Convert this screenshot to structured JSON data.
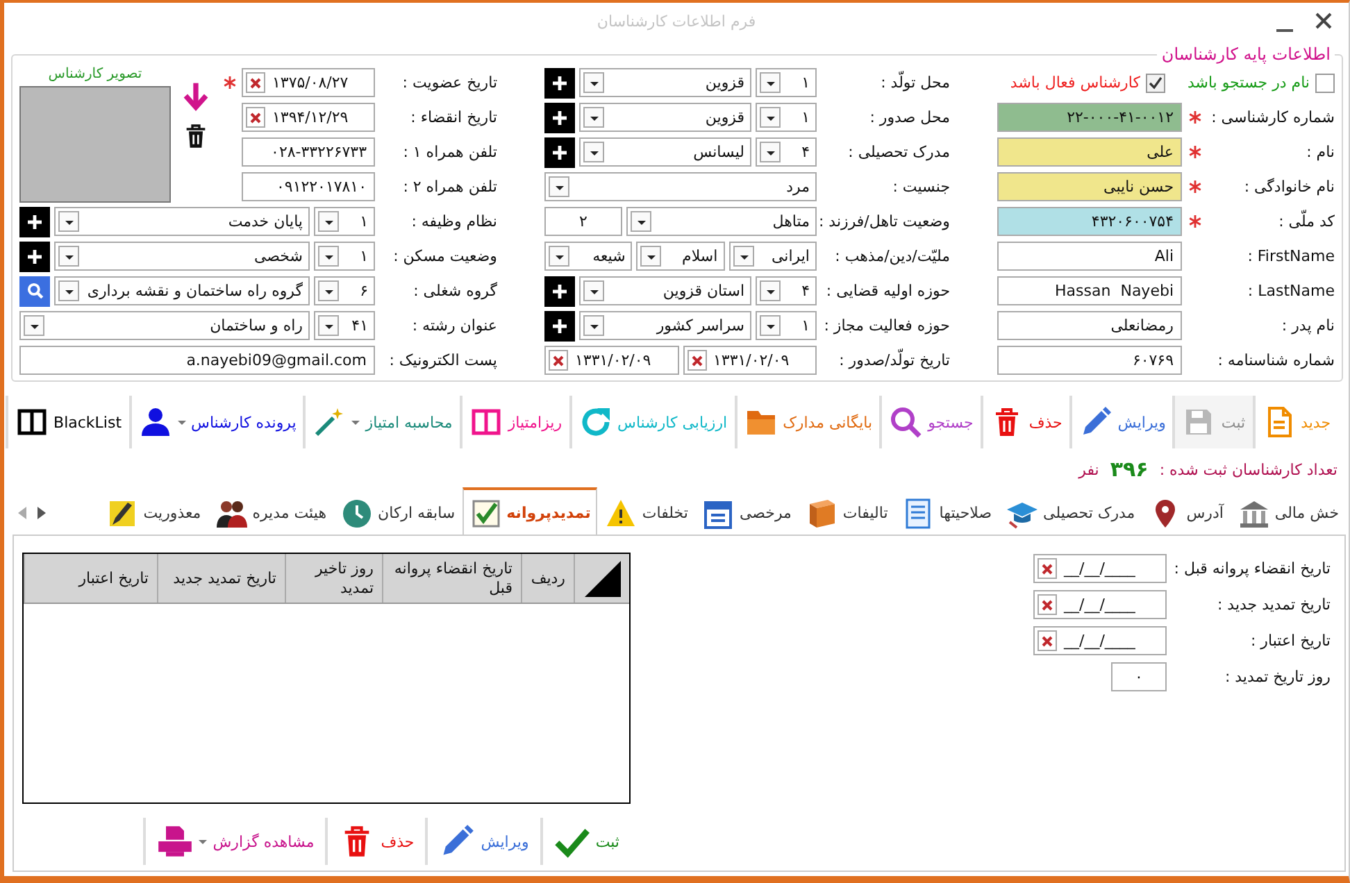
{
  "window": {
    "title": "فرم اطلاعات کارشناسان"
  },
  "basic_info": {
    "legend": "اطلاعات پایه کارشناسان",
    "checkboxes": [
      {
        "label": "نام در جستجو باشد",
        "checked": false,
        "color": "#169b16"
      },
      {
        "label": "کارشناس فعال باشد",
        "checked": true,
        "color": "#ee2020"
      }
    ],
    "identity_fields": [
      {
        "label": "شماره کارشناسی :",
        "value": "۲۲-۰۰۰-۴۱-۰۰۱۲",
        "required": true,
        "color": "#8fbc8f"
      },
      {
        "label": "نام :",
        "value": "علی",
        "required": true,
        "color": "#f0e68c"
      },
      {
        "label": "نام خانوادگی :",
        "value": "حسن نایبی",
        "required": true,
        "color": "#f0e68c"
      },
      {
        "label": "کد ملّی :",
        "value": "۴۳۲۰۶۰۰۷۵۴",
        "required": true,
        "color": "#b0e0e6"
      },
      {
        "label": "FirstName :",
        "value": "Ali",
        "required": false
      },
      {
        "label": "LastName :",
        "value": "Hassan  Nayebi",
        "required": false
      },
      {
        "label": "نام پدر :",
        "value": "رمضانعلی",
        "required": false
      },
      {
        "label": "شماره شناسنامه :",
        "value": "۶۰۷۶۹",
        "required": false
      }
    ],
    "origin_fields": [
      {
        "kind": "combo",
        "label": "محل تولّد :",
        "code": "۱",
        "value": "قزوین",
        "button": {
          "kind": "add"
        }
      },
      {
        "kind": "combo",
        "label": "محل صدور :",
        "code": "۱",
        "value": "قزوین",
        "button": {
          "kind": "add"
        }
      },
      {
        "kind": "combo",
        "label": "مدرک تحصیلی :",
        "code": "۴",
        "value": "لیسانس",
        "button": {
          "kind": "add"
        }
      },
      {
        "kind": "dropdown",
        "label": "جنسیت :",
        "value": "مرد"
      },
      {
        "kind": "dropdown_count",
        "label": "وضعیت تاهل/فرزند :",
        "value": "متاهل",
        "count": "۲"
      },
      {
        "kind": "dropdowns",
        "label": "ملیّت/دین/مذهب :",
        "values": [
          "ایرانی",
          "اسلام",
          "شیعه"
        ]
      },
      {
        "kind": "combo",
        "label": "حوزه اولیه قضایی :",
        "code": "۴",
        "value": "استان قزوین",
        "button": {
          "kind": "add"
        }
      },
      {
        "kind": "combo",
        "label": "حوزه فعالیت مجاز :",
        "code": "۱",
        "value": "سراسر کشور",
        "button": {
          "kind": "add"
        }
      },
      {
        "kind": "dates",
        "label": "تاریخ تولّد/صدور :",
        "values": [
          "۱۳۳۱/۰۲/۰۹",
          "۱۳۳۱/۰۲/۰۹"
        ]
      }
    ],
    "photo": {
      "caption": "تصویر کارشناس"
    },
    "membership_fields": [
      {
        "kind": "date",
        "label": "تاریخ عضویت :",
        "value": "۱۳۷۵/۰۸/۲۷",
        "required": true
      },
      {
        "kind": "date",
        "label": "تاریخ انقضاء :",
        "value": "۱۳۹۴/۱۲/۲۹",
        "required": false
      },
      {
        "kind": "text",
        "label": "تلفن همراه ۱ :",
        "value": "۰۲۸-۳۳۲۲۶۷۳۳",
        "required": false
      },
      {
        "kind": "text",
        "label": "تلفن همراه ۲ :",
        "value": "۰۹۱۲۲۰۱۷۸۱۰",
        "required": false
      }
    ],
    "job_fields": [
      {
        "kind": "combo",
        "label": "نظام وظیفه :",
        "code": "۱",
        "value": "پایان خدمت",
        "button": {
          "kind": "add"
        }
      },
      {
        "kind": "combo",
        "label": "وضعیت مسکن :",
        "code": "۱",
        "value": "شخصی",
        "button": {
          "kind": "add"
        }
      },
      {
        "kind": "combo",
        "label": "گروه شغلی :",
        "code": "۶",
        "value": "گروه راه ساختمان و نقشه برداری",
        "button": {
          "kind": "search"
        }
      },
      {
        "kind": "combo",
        "label": "عنوان رشته :",
        "code": "۴۱",
        "value": "راه و ساختمان"
      },
      {
        "kind": "text",
        "label": "پست الکترونیک :",
        "value": "a.nayebi09@gmail.com"
      }
    ]
  },
  "toolbar": [
    {
      "label": "جدید",
      "color": "#f08c00",
      "disabled": false,
      "menu": false
    },
    {
      "label": "ثبت",
      "color": "#8c8c8c",
      "disabled": true,
      "menu": false
    },
    {
      "label": "ویرایش",
      "color": "#3b6fd8",
      "disabled": false,
      "menu": false
    },
    {
      "label": "حذف",
      "color": "#e81010",
      "disabled": false,
      "menu": false
    },
    {
      "label": "جستجو",
      "color": "#b040c8",
      "disabled": false,
      "menu": false
    },
    {
      "label": "بایگانی مدارک",
      "color": "#e06a10",
      "disabled": false,
      "menu": false
    },
    {
      "label": "ارزیابی کارشناس",
      "color": "#10b8c8",
      "disabled": false,
      "menu": false
    },
    {
      "label": "ریزامتیاز",
      "color": "#f0148c",
      "disabled": false,
      "menu": false
    },
    {
      "label": "محاسبه امتیاز",
      "color": "#1a8a7a",
      "disabled": false,
      "menu": true
    },
    {
      "label": "پرونده کارشناس",
      "color": "#1010e0",
      "disabled": false,
      "menu": true
    },
    {
      "label": "BlackList",
      "color": "#000000",
      "disabled": false,
      "menu": false
    }
  ],
  "count": {
    "label": "تعداد کارشناسان ثبت شده :",
    "value": "۳۹۶",
    "unit": "نفر"
  },
  "tabs": [
    {
      "label": "خش مالی",
      "selected": false
    },
    {
      "label": "آدرس",
      "selected": false
    },
    {
      "label": "مدرک تحصیلی",
      "selected": false
    },
    {
      "label": "صلاحیتها",
      "selected": false
    },
    {
      "label": "تالیفات",
      "selected": false
    },
    {
      "label": "مرخصی",
      "selected": false
    },
    {
      "label": "تخلفات",
      "selected": false
    },
    {
      "label": "تمدیدپروانه",
      "selected": true
    },
    {
      "label": "سابقه ارکان",
      "selected": false
    },
    {
      "label": "هیئت مدیره",
      "selected": false
    },
    {
      "label": "معذوریت",
      "selected": false
    }
  ],
  "renewal_form": [
    {
      "kind": "date",
      "label": "تاریخ انقضاء پروانه قبل :",
      "value": "__/__/____"
    },
    {
      "kind": "date",
      "label": "تاریخ تمدید جدید :",
      "value": "__/__/____"
    },
    {
      "kind": "date",
      "label": "تاریخ اعتبار :",
      "value": "__/__/____"
    },
    {
      "kind": "number",
      "label": "روز تاریخ تمدید :",
      "value": "۰"
    }
  ],
  "renewal_table": {
    "columns": [
      "ردیف",
      "تاریخ انقضاء پروانه قبل",
      "روز تاخیر تمدید",
      "تاریخ تمدید جدید",
      "تاریخ اعتبار"
    ]
  },
  "renewal_actions": [
    {
      "label": "ثبت",
      "color": "#1a8a1a",
      "menu": false
    },
    {
      "label": "ویرایش",
      "color": "#3b6fd8",
      "menu": false
    },
    {
      "label": "حذف",
      "color": "#e81010",
      "menu": false
    },
    {
      "label": "مشاهده گزارش",
      "color": "#c8148c",
      "menu": true
    }
  ]
}
